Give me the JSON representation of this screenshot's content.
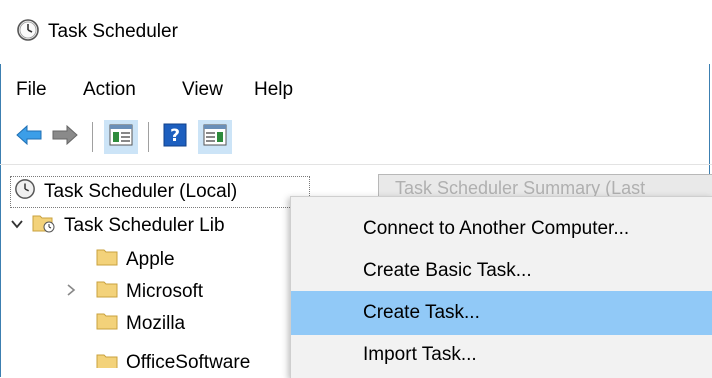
{
  "window": {
    "title": "Task Scheduler"
  },
  "menubar": {
    "items": [
      "File",
      "Action",
      "View",
      "Help"
    ]
  },
  "toolbar": {
    "buttons": [
      "back-arrow-icon",
      "forward-arrow-icon",
      "show-hide-console-tree-icon",
      "help-icon",
      "show-hide-action-pane-icon"
    ]
  },
  "tree": {
    "root": "Task Scheduler (Local)",
    "library": "Task Scheduler Lib",
    "folders": [
      "Apple",
      "Microsoft",
      "Mozilla",
      "OfficeSoftware"
    ]
  },
  "summary_header": "Task Scheduler Summary (Last",
  "context_menu": {
    "items": [
      "Connect to Another Computer...",
      "Create Basic Task...",
      "Create Task...",
      "Import Task..."
    ],
    "highlighted": "Create Task..."
  },
  "colors": {
    "highlight": "#91c9f7",
    "toolbar_highlight": "#cce4f7",
    "frame": "#3c7fb1"
  }
}
